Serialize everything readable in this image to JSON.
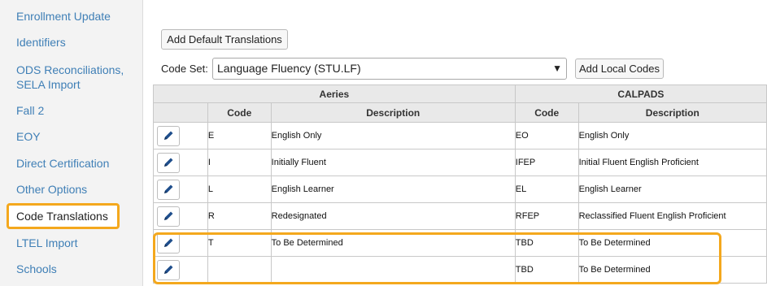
{
  "sidebar": {
    "items": [
      {
        "label": "Enrollment Update"
      },
      {
        "label": "Identifiers"
      },
      {
        "label": "ODS Reconciliations, SELA Import"
      },
      {
        "label": "Fall 2"
      },
      {
        "label": "EOY"
      },
      {
        "label": "Direct Certification"
      },
      {
        "label": "Other Options"
      },
      {
        "label": "Code Translations"
      },
      {
        "label": "LTEL Import"
      },
      {
        "label": "Schools"
      }
    ],
    "active_index": 7
  },
  "toolbar": {
    "add_default_label": "Add Default Translations",
    "code_set_label": "Code Set:",
    "code_set_value": "Language Fluency (STU.LF)",
    "add_local_label": "Add Local Codes"
  },
  "table": {
    "group_headers": {
      "aeries": "Aeries",
      "calpads": "CALPADS"
    },
    "column_headers": {
      "code": "Code",
      "description": "Description",
      "code2": "Code",
      "description2": "Description"
    },
    "rows": [
      {
        "aeries_code": "E",
        "aeries_desc": "English Only",
        "calpads_code": "EO",
        "calpads_desc": "English Only"
      },
      {
        "aeries_code": "I",
        "aeries_desc": "Initially Fluent",
        "calpads_code": "IFEP",
        "calpads_desc": "Initial Fluent English Proficient"
      },
      {
        "aeries_code": "L",
        "aeries_desc": "English Learner",
        "calpads_code": "EL",
        "calpads_desc": "English Learner"
      },
      {
        "aeries_code": "R",
        "aeries_desc": "Redesignated",
        "calpads_code": "RFEP",
        "calpads_desc": "Reclassified Fluent English Proficient"
      },
      {
        "aeries_code": "T",
        "aeries_desc": "To Be Determined",
        "calpads_code": "TBD",
        "calpads_desc": "To Be Determined"
      },
      {
        "aeries_code": "",
        "aeries_desc": "",
        "calpads_code": "TBD",
        "calpads_desc": "To Be Determined"
      }
    ]
  },
  "colors": {
    "link": "#3f7fb6",
    "highlight": "#f4a81d",
    "icon": "#1f4e8c"
  }
}
